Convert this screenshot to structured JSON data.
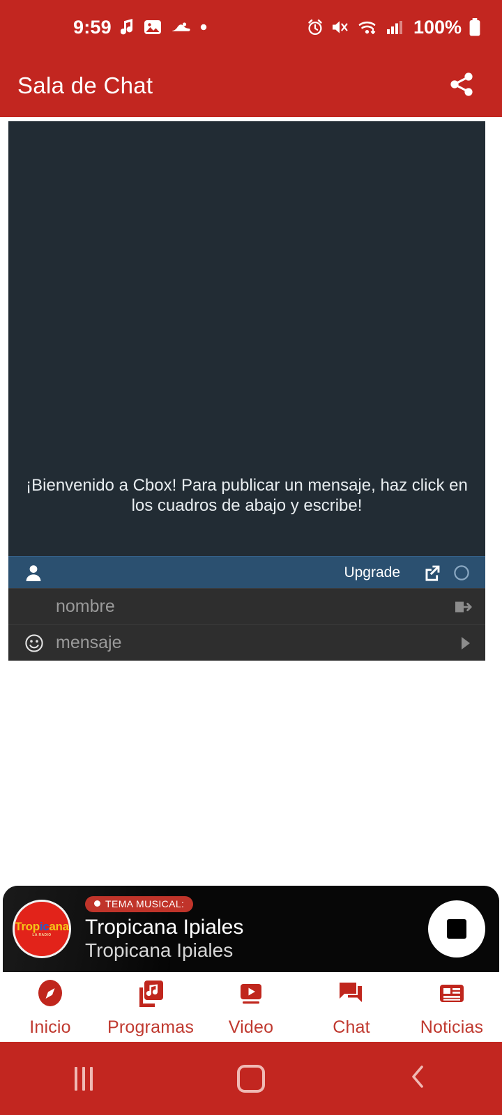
{
  "status_bar": {
    "time": "9:59",
    "battery_percent": "100%",
    "left_icons": [
      "music-note-icon",
      "image-icon",
      "shoe-icon",
      "dot-icon"
    ],
    "right_icons": [
      "alarm-icon",
      "mute-vibrate-icon",
      "wifi-icon",
      "signal-icon",
      "battery-icon"
    ]
  },
  "app_bar": {
    "title": "Sala de Chat",
    "share_icon": "share-icon"
  },
  "chat": {
    "welcome_message": "¡Bienvenido a Cbox! Para publicar un mensaje, haz click en los cuadros de abajo y escribe!",
    "toolbar": {
      "user_icon": "user-icon",
      "upgrade_label": "Upgrade",
      "popout_icon": "external-link-icon",
      "refresh_icon": "circle-icon"
    },
    "name_field": {
      "placeholder": "nombre",
      "submit_icon": "login-arrow-icon"
    },
    "message_field": {
      "placeholder": "mensaje",
      "emoji_icon": "smiley-icon",
      "send_icon": "send-triangle-icon"
    }
  },
  "player": {
    "badge_label": "TEMA MUSICAL:",
    "title": "Tropicana Ipiales",
    "subtitle": "Tropicana Ipiales",
    "logo_text_a": "Trop",
    "logo_text_b": "ic",
    "logo_text_c": "ana",
    "logo_tagline": "LA RADIO",
    "stop_icon": "stop-icon"
  },
  "bottom_nav": {
    "items": [
      {
        "label": "Inicio",
        "icon": "compass-icon"
      },
      {
        "label": "Programas",
        "icon": "music-library-icon"
      },
      {
        "label": "Video",
        "icon": "video-play-icon"
      },
      {
        "label": "Chat",
        "icon": "chat-bubbles-icon"
      },
      {
        "label": "Noticias",
        "icon": "news-article-icon"
      }
    ]
  },
  "system_nav": {
    "recents_icon": "recents-icon",
    "home_icon": "home-icon",
    "back_icon": "back-chevron-icon"
  },
  "colors": {
    "brand_red": "#c22620",
    "chat_bg": "#222c34",
    "cbox_toolbar": "#2b5070",
    "cbox_field": "#2e2e2e",
    "player_bg": "#070707",
    "nav_label": "#c0392f"
  }
}
